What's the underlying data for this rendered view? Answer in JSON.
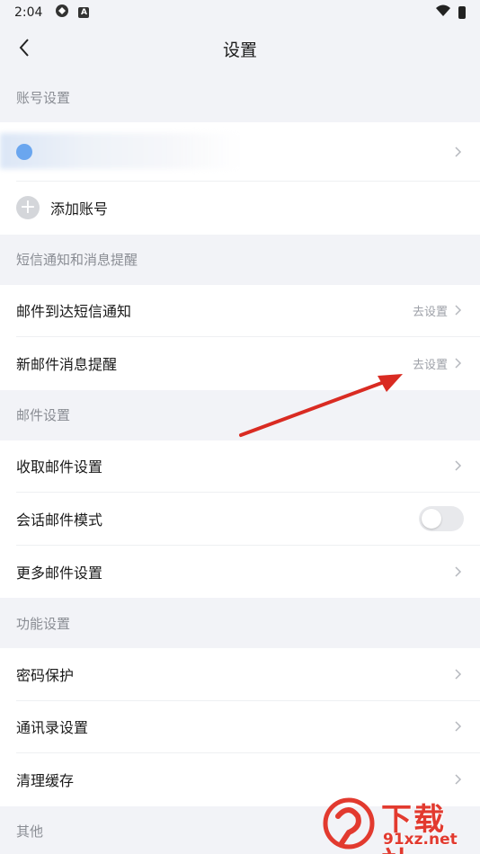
{
  "status_bar": {
    "time": "2:04"
  },
  "header": {
    "title": "设置"
  },
  "sections": {
    "account": {
      "header": "账号设置",
      "add_account": "添加账号"
    },
    "sms": {
      "header": "短信通知和消息提醒",
      "items": [
        {
          "label": "邮件到达短信通知",
          "hint": "去设置"
        },
        {
          "label": "新邮件消息提醒",
          "hint": "去设置"
        }
      ]
    },
    "mail": {
      "header": "邮件设置",
      "items": [
        {
          "label": "收取邮件设置"
        },
        {
          "label": "会话邮件模式",
          "toggle": false
        },
        {
          "label": "更多邮件设置"
        }
      ]
    },
    "function": {
      "header": "功能设置",
      "items": [
        {
          "label": "密码保护"
        },
        {
          "label": "通讯录设置"
        },
        {
          "label": "清理缓存"
        }
      ]
    },
    "other": {
      "header": "其他"
    }
  },
  "watermark": {
    "line1": "下载站",
    "line2": "91xz.net"
  },
  "colors": {
    "accent_red": "#e23a2f",
    "toggle_off": "#e8e9ec"
  }
}
